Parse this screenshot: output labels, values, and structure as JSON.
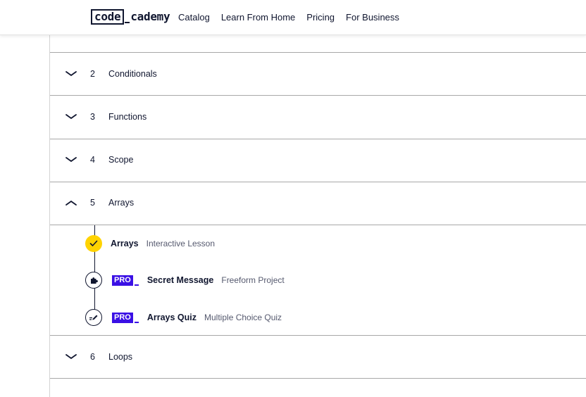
{
  "header": {
    "logo_code": "code",
    "logo_academy": "cademy",
    "nav": [
      "Catalog",
      "Learn From Home",
      "Pricing",
      "For Business"
    ]
  },
  "modules": [
    {
      "number": "2",
      "title": "Conditionals",
      "expanded": false
    },
    {
      "number": "3",
      "title": "Functions",
      "expanded": false
    },
    {
      "number": "4",
      "title": "Scope",
      "expanded": false
    },
    {
      "number": "5",
      "title": "Arrays",
      "expanded": true
    },
    {
      "number": "6",
      "title": "Loops",
      "expanded": false
    }
  ],
  "arrays_items": [
    {
      "name": "Arrays",
      "type": "Interactive Lesson",
      "pro": false,
      "status": "completed",
      "icon": "check-icon"
    },
    {
      "name": "Secret Message",
      "type": "Freeform Project",
      "pro": true,
      "status": "locked",
      "icon": "puzzle-icon"
    },
    {
      "name": "Arrays Quiz",
      "type": "Multiple Choice Quiz",
      "pro": true,
      "status": "locked",
      "icon": "quiz-pencil-icon"
    }
  ],
  "pro_label": "PRO",
  "colors": {
    "text": "#10162f",
    "pro": "#3a10e5",
    "completed": "#ffd300",
    "divider": "#a8a8a8"
  }
}
